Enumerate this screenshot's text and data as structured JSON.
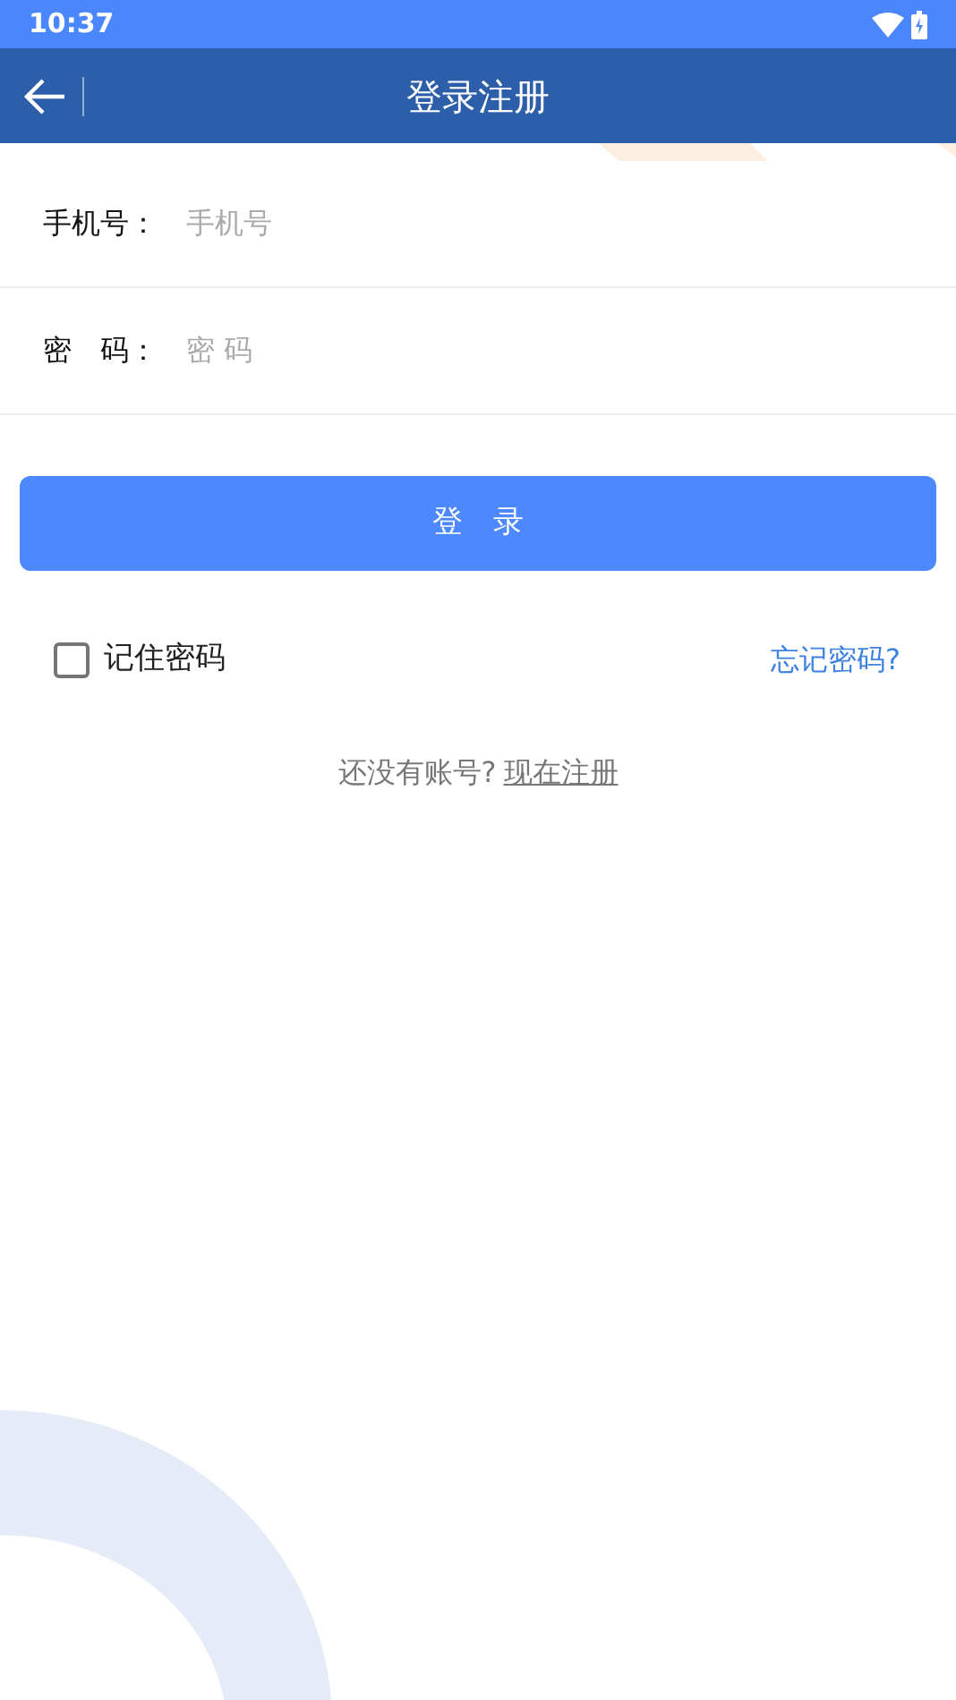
{
  "status_bar": {
    "time": "10:37"
  },
  "header": {
    "title": "登录注册"
  },
  "fields": [
    {
      "label": "手机号：",
      "placeholder": "手机号"
    },
    {
      "label": "密　码：",
      "placeholder": "密 码"
    }
  ],
  "login_button": {
    "label": "登　录"
  },
  "remember": {
    "label": "记住密码",
    "checked": false
  },
  "forgot_link": "忘记密码?",
  "register": {
    "prompt": "还没有账号?",
    "link": "现在注册"
  }
}
